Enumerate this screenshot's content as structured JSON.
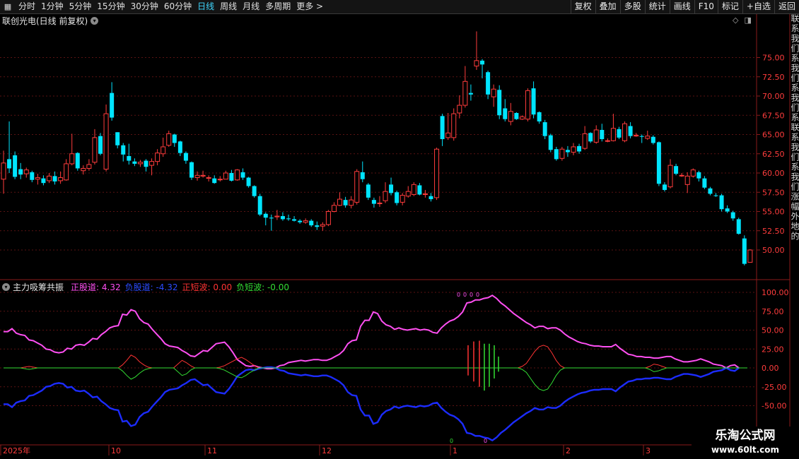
{
  "toolbar": {
    "back_icon": "grid-icon",
    "periods": [
      "分时",
      "1分钟",
      "5分钟",
      "15分钟",
      "30分钟",
      "60分钟",
      "日线",
      "周线",
      "月线",
      "多周期",
      "更多 >"
    ],
    "active_period": "日线",
    "right_buttons": [
      "复权",
      "叠加",
      "多股",
      "统计",
      "画线",
      "F10",
      "标记",
      "+自选",
      "返回"
    ]
  },
  "main": {
    "title": "联创光电(日线 前复权)",
    "price_labels": [
      "75.00",
      "72.50",
      "70.00",
      "67.50",
      "65.00",
      "62.50",
      "60.00",
      "57.50",
      "55.00",
      "52.50",
      "50.00"
    ],
    "colors": {
      "up": "#ff3c3c",
      "down": "#00e5ff",
      "grid": "#5a1212"
    },
    "candles": [
      [
        59.2,
        61.3,
        62.9,
        57.3
      ],
      [
        61.8,
        60.6,
        66.7,
        60.0
      ],
      [
        62.3,
        59.5,
        62.8,
        59.2
      ],
      [
        60.5,
        59.8,
        61.3,
        59.2
      ],
      [
        59.9,
        60.4,
        60.7,
        59.4
      ],
      [
        60.1,
        59.1,
        60.3,
        58.8
      ],
      [
        59.2,
        59.4,
        59.9,
        58.5
      ],
      [
        59.3,
        58.7,
        59.7,
        58.4
      ],
      [
        59.0,
        59.6,
        60.0,
        58.7
      ],
      [
        59.6,
        58.9,
        60.2,
        58.5
      ],
      [
        59.0,
        59.4,
        60.2,
        58.6
      ],
      [
        59.1,
        61.2,
        61.8,
        59.0
      ],
      [
        61.2,
        62.5,
        65.1,
        61.0
      ],
      [
        62.6,
        60.6,
        62.7,
        60.3
      ],
      [
        60.3,
        60.6,
        61.0,
        59.8
      ],
      [
        60.6,
        61.1,
        61.8,
        60.3
      ],
      [
        61.4,
        64.6,
        65.7,
        61.1
      ],
      [
        64.8,
        62.5,
        65.2,
        62.3
      ],
      [
        60.5,
        67.7,
        68.9,
        60.2
      ],
      [
        70.4,
        67.2,
        71.8,
        66.8
      ],
      [
        65.3,
        63.6,
        65.3,
        63.2
      ],
      [
        63.6,
        62.4,
        63.9,
        61.5
      ],
      [
        62.2,
        61.6,
        63.8,
        61.1
      ],
      [
        61.5,
        61.2,
        61.9,
        60.9
      ],
      [
        61.2,
        61.4,
        61.7,
        60.8
      ],
      [
        61.6,
        60.8,
        61.8,
        60.2
      ],
      [
        61.0,
        61.5,
        61.9,
        59.7
      ],
      [
        61.5,
        62.6,
        63.1,
        61.0
      ],
      [
        62.5,
        63.4,
        64.6,
        62.1
      ],
      [
        63.6,
        65.1,
        65.5,
        63.4
      ],
      [
        65.0,
        63.9,
        65.1,
        63.4
      ],
      [
        64.1,
        62.6,
        64.2,
        62.2
      ],
      [
        62.6,
        61.6,
        62.8,
        61.2
      ],
      [
        61.4,
        59.4,
        61.5,
        59.1
      ],
      [
        59.4,
        59.7,
        60.2,
        59.0
      ],
      [
        59.6,
        59.7,
        60.3,
        59.4
      ],
      [
        59.3,
        59.4,
        59.7,
        58.9
      ],
      [
        59.3,
        58.7,
        59.7,
        58.6
      ],
      [
        59.2,
        59.2,
        59.6,
        58.9
      ],
      [
        59.2,
        60.0,
        60.3,
        59.2
      ],
      [
        60.0,
        59.0,
        60.4,
        58.9
      ],
      [
        59.1,
        60.4,
        60.5,
        59.0
      ],
      [
        60.1,
        59.4,
        60.6,
        59.1
      ],
      [
        59.4,
        58.3,
        59.5,
        58.1
      ],
      [
        58.3,
        57.0,
        58.4,
        56.8
      ],
      [
        57.0,
        54.6,
        57.3,
        54.4
      ],
      [
        54.7,
        54.2,
        54.9,
        53.2
      ],
      [
        54.2,
        54.1,
        54.6,
        52.5
      ],
      [
        54.3,
        54.4,
        55.2,
        53.9
      ],
      [
        54.4,
        54.0,
        54.9,
        53.8
      ],
      [
        54.1,
        54.0,
        54.6,
        53.8
      ],
      [
        54.0,
        53.8,
        54.4,
        53.7
      ],
      [
        53.8,
        53.6,
        54.0,
        53.4
      ],
      [
        53.6,
        53.8,
        54.1,
        53.4
      ],
      [
        53.8,
        53.2,
        54.0,
        53.0
      ],
      [
        53.2,
        53.0,
        53.7,
        52.6
      ],
      [
        53.1,
        53.3,
        53.6,
        52.5
      ],
      [
        53.3,
        55.0,
        55.2,
        53.1
      ],
      [
        55.0,
        55.8,
        56.2,
        54.9
      ],
      [
        55.8,
        56.6,
        57.5,
        55.7
      ],
      [
        56.5,
        55.8,
        56.9,
        55.5
      ],
      [
        55.8,
        56.5,
        57.0,
        55.4
      ],
      [
        56.2,
        60.2,
        60.5,
        55.9
      ],
      [
        60.1,
        59.2,
        61.5,
        58.8
      ],
      [
        58.5,
        56.8,
        58.7,
        56.5
      ],
      [
        56.5,
        56.0,
        56.8,
        55.5
      ],
      [
        56.1,
        56.1,
        57.0,
        55.6
      ],
      [
        56.4,
        57.6,
        58.8,
        56.1
      ],
      [
        58.5,
        57.4,
        59.4,
        57.1
      ],
      [
        57.5,
        56.1,
        57.7,
        55.8
      ],
      [
        56.2,
        57.1,
        57.4,
        55.8
      ],
      [
        57.0,
        57.6,
        58.3,
        56.8
      ],
      [
        57.2,
        58.5,
        58.8,
        57.0
      ],
      [
        58.4,
        57.2,
        58.7,
        57.1
      ],
      [
        57.2,
        57.3,
        57.8,
        56.8
      ],
      [
        57.0,
        56.6,
        57.4,
        56.3
      ],
      [
        56.8,
        63.1,
        63.3,
        56.5
      ],
      [
        67.4,
        64.4,
        67.7,
        63.5
      ],
      [
        64.6,
        65.2,
        67.8,
        64.3
      ],
      [
        64.6,
        67.7,
        68.4,
        64.2
      ],
      [
        67.8,
        68.8,
        70.1,
        67.1
      ],
      [
        68.8,
        71.9,
        73.9,
        68.5
      ],
      [
        70.4,
        70.2,
        71.5,
        69.4
      ],
      [
        73.9,
        74.6,
        78.4,
        73.4
      ],
      [
        74.6,
        74.1,
        74.8,
        72.3
      ],
      [
        73.1,
        70.2,
        73.3,
        69.6
      ],
      [
        69.9,
        70.9,
        71.5,
        68.6
      ],
      [
        70.8,
        67.5,
        71.4,
        67.0
      ],
      [
        68.4,
        67.0,
        69.6,
        66.7
      ],
      [
        66.7,
        68.0,
        69.1,
        66.2
      ],
      [
        67.8,
        67.0,
        67.9,
        66.9
      ],
      [
        67.0,
        67.3,
        67.5,
        66.9
      ],
      [
        67.0,
        70.7,
        71.0,
        66.7
      ],
      [
        71.0,
        67.6,
        71.9,
        67.1
      ],
      [
        67.9,
        66.7,
        68.0,
        66.4
      ],
      [
        66.6,
        64.8,
        66.9,
        64.4
      ],
      [
        64.9,
        63.0,
        65.1,
        62.7
      ],
      [
        63.1,
        61.8,
        63.4,
        61.6
      ],
      [
        61.9,
        63.1,
        63.4,
        61.6
      ],
      [
        63.0,
        62.7,
        63.5,
        62.1
      ],
      [
        62.7,
        63.4,
        63.9,
        62.3
      ],
      [
        63.5,
        62.8,
        63.8,
        62.5
      ],
      [
        63.2,
        65.1,
        66.1,
        63.0
      ],
      [
        65.2,
        64.1,
        65.3,
        63.9
      ],
      [
        64.0,
        65.6,
        66.2,
        63.8
      ],
      [
        65.6,
        64.4,
        66.4,
        64.1
      ],
      [
        64.2,
        64.2,
        64.5,
        64.0
      ],
      [
        64.2,
        65.8,
        67.7,
        64.1
      ],
      [
        65.7,
        64.6,
        66.0,
        64.4
      ],
      [
        64.2,
        66.4,
        66.7,
        64.0
      ],
      [
        66.1,
        64.8,
        66.6,
        64.5
      ],
      [
        64.8,
        64.9,
        65.2,
        64.7
      ],
      [
        64.8,
        64.7,
        65.0,
        63.9
      ],
      [
        64.5,
        64.8,
        65.5,
        64.3
      ],
      [
        64.7,
        63.9,
        64.9,
        63.7
      ],
      [
        64.0,
        58.6,
        64.1,
        58.3
      ],
      [
        58.5,
        57.8,
        58.8,
        57.6
      ],
      [
        58.2,
        61.0,
        61.8,
        58.0
      ],
      [
        60.9,
        59.9,
        61.2,
        59.7
      ],
      [
        59.7,
        59.7,
        60.0,
        59.5
      ],
      [
        58.5,
        59.6,
        60.1,
        57.4
      ],
      [
        59.6,
        60.4,
        60.6,
        59.4
      ],
      [
        60.1,
        59.3,
        60.3,
        58.9
      ],
      [
        59.3,
        58.1,
        59.6,
        57.9
      ],
      [
        58.0,
        57.3,
        58.2,
        57.1
      ],
      [
        57.1,
        57.0,
        57.4,
        56.9
      ],
      [
        57.1,
        55.3,
        57.3,
        55.0
      ],
      [
        55.4,
        55.0,
        55.8,
        54.8
      ],
      [
        54.9,
        54.1,
        55.1,
        53.8
      ],
      [
        54.0,
        52.1,
        54.2,
        52.0
      ],
      [
        51.5,
        48.2,
        51.9,
        48.0
      ],
      [
        48.4,
        50.0,
        50.1,
        48.4
      ]
    ]
  },
  "indicator": {
    "name": "主力吸筹共振",
    "items": [
      {
        "label": "正股道:",
        "value": "4.32",
        "color": "#ff4ff2"
      },
      {
        "label": "负股道:",
        "value": "-4.32",
        "color": "#2b4bff"
      },
      {
        "label": "正短波:",
        "value": "0.00",
        "color": "#ff3333"
      },
      {
        "label": "负短波:",
        "value": "-0.00",
        "color": "#33dd33"
      }
    ],
    "levels": [
      "100.00",
      "75.00",
      "50.00",
      "25.00",
      "0.00",
      "-25.00",
      "-50.00"
    ],
    "pos_line": [
      48,
      48,
      52,
      46,
      44,
      43,
      37,
      36,
      33,
      30,
      25,
      24,
      21,
      20,
      21,
      26,
      25,
      30,
      31,
      30,
      34,
      39,
      38,
      44,
      48,
      53,
      55,
      56,
      71,
      70,
      77,
      75,
      65,
      60,
      58,
      51,
      45,
      39,
      32,
      29,
      28,
      27,
      23,
      20,
      16,
      15,
      19,
      23,
      22,
      27,
      32,
      33,
      34,
      28,
      20,
      11,
      7,
      3,
      2,
      3,
      1,
      0,
      -1,
      -1,
      0,
      3,
      4,
      7,
      8,
      9,
      10,
      9,
      10,
      11,
      11,
      10,
      10,
      12,
      15,
      18,
      23,
      32,
      36,
      37,
      55,
      63,
      63,
      74,
      72,
      62,
      57,
      55,
      51,
      53,
      51,
      50,
      51,
      52,
      50,
      51,
      50,
      47,
      46,
      53,
      58,
      62,
      64,
      68,
      74,
      86,
      87,
      90,
      90,
      92,
      93,
      96,
      92,
      86,
      82,
      77,
      72,
      68,
      64,
      60,
      57,
      53,
      55,
      55,
      52,
      53,
      53,
      50,
      45,
      41,
      38,
      35,
      33,
      32,
      30,
      29,
      29,
      28,
      28,
      28,
      31,
      26,
      22,
      18,
      17,
      15,
      15,
      14,
      14,
      13,
      13,
      14,
      15,
      15,
      12,
      10,
      8,
      8,
      9,
      10,
      12,
      10,
      8,
      5,
      4,
      3,
      0,
      3,
      4,
      0
    ],
    "short_pos": [
      0,
      0,
      0,
      0,
      0,
      1,
      2,
      1,
      0,
      0,
      0,
      0,
      0,
      0,
      0,
      0,
      0,
      0,
      0,
      0,
      0,
      0,
      0,
      0,
      0,
      0,
      0,
      0,
      4,
      10,
      17,
      14,
      8,
      4,
      1,
      0,
      0,
      0,
      0,
      0,
      0,
      5,
      10,
      7,
      3,
      0,
      0,
      0,
      0,
      0,
      0,
      1,
      3,
      6,
      9,
      12,
      14,
      11,
      7,
      3,
      0,
      0,
      0,
      0,
      0,
      0,
      0,
      0,
      0,
      0,
      0,
      0,
      0,
      0,
      0,
      0,
      0,
      0,
      0,
      0,
      0,
      0,
      0,
      0,
      0,
      0,
      0,
      0,
      0,
      0,
      0,
      0,
      0,
      0,
      0,
      0,
      0,
      0,
      0,
      0,
      0,
      0,
      0,
      0,
      0,
      0,
      0,
      0,
      0,
      0,
      0,
      0,
      0,
      0,
      0,
      0,
      0,
      0,
      0,
      0,
      0,
      0,
      2,
      6,
      14,
      22,
      28,
      30,
      28,
      20,
      10,
      3,
      0,
      0,
      0,
      0,
      0,
      0,
      0,
      0,
      0,
      0,
      0,
      0,
      0,
      0,
      0,
      0,
      0,
      0,
      0,
      0,
      2,
      5,
      4,
      2,
      0,
      0,
      0,
      0,
      0,
      0,
      0,
      0,
      0,
      0,
      0,
      0,
      0,
      0,
      0,
      0,
      0,
      0,
      0,
      0
    ],
    "short_neg": [
      0,
      0,
      0,
      0,
      0,
      -1,
      -2,
      -1,
      0,
      0,
      0,
      0,
      0,
      0,
      0,
      0,
      0,
      0,
      0,
      0,
      0,
      0,
      0,
      0,
      0,
      0,
      0,
      0,
      -4,
      -10,
      -15,
      -12,
      -7,
      -3,
      -1,
      0,
      0,
      0,
      0,
      0,
      0,
      -5,
      -10,
      -8,
      -3,
      0,
      0,
      0,
      0,
      0,
      0,
      -1,
      -3,
      -6,
      -9,
      -12,
      -13,
      -10,
      -6,
      -3,
      0,
      0,
      0,
      0,
      0,
      0,
      0,
      0,
      0,
      0,
      0,
      0,
      0,
      0,
      0,
      0,
      0,
      0,
      0,
      0,
      0,
      0,
      0,
      0,
      0,
      0,
      0,
      0,
      0,
      0,
      0,
      0,
      0,
      0,
      0,
      0,
      0,
      0,
      0,
      0,
      0,
      0,
      0,
      0,
      0,
      0,
      0,
      0,
      0,
      0,
      0,
      0,
      0,
      0,
      0,
      0,
      0,
      0,
      0,
      0,
      0,
      0,
      -2,
      -6,
      -14,
      -22,
      -28,
      -30,
      -28,
      -20,
      -10,
      -3,
      0,
      0,
      0,
      0,
      0,
      0,
      0,
      0,
      0,
      0,
      0,
      0,
      0,
      0,
      0,
      0,
      0,
      0,
      0,
      0,
      -2,
      -5,
      -4,
      -2,
      0,
      0,
      0,
      0,
      0,
      0,
      0,
      0,
      0,
      0,
      0,
      0,
      0,
      0,
      0,
      0,
      0,
      0,
      0,
      0
    ],
    "markers_top": "0000",
    "marker_green": "0",
    "marker_pink": "0"
  },
  "xaxis": {
    "labels": [
      "2025年",
      "10",
      "11",
      "12",
      "1",
      "2",
      "3"
    ]
  },
  "watermark": {
    "line1": "乐淘公式网",
    "line2": "www.60lt.com"
  },
  "side_strip": {
    "text": "联系我们系我们系我们系联系我们系我们涨幅外地的"
  }
}
